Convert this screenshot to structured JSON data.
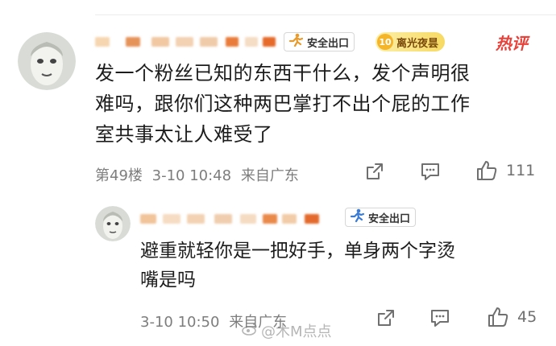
{
  "comment": {
    "lines": [
      "发一个粉丝已知的东西干什么，发个声明很",
      "难吗，跟你们这种两巴掌打不出个屁的工作",
      "室共事太让人难受了"
    ],
    "badges": {
      "safe_exit": "安全出口",
      "level_number": "10",
      "level_label": "离光夜昙",
      "hot": "热评"
    },
    "floor": "第49楼",
    "time": "3-10 10:48",
    "location": "来自广东",
    "like_count": "111"
  },
  "reply": {
    "lines": [
      "避重就轻你是一把好手，单身两个字烫",
      "嘴是吗"
    ],
    "badges": {
      "safe_exit": "安全出口"
    },
    "time": "3-10 10:50",
    "location": "来自广东",
    "like_count": "45"
  },
  "watermark": "@木M点点",
  "icons": {
    "safe_exit": "running-man-icon",
    "share": "share-icon",
    "reply": "comment-icon",
    "like": "thumbs-up-icon",
    "watermark": "weibo-logo-icon"
  },
  "colors": {
    "hot": "#e8413a",
    "safe_exit_icon": "#e89a2b",
    "meta_text": "#7d7d7d",
    "level_badge": "#f7da63"
  }
}
